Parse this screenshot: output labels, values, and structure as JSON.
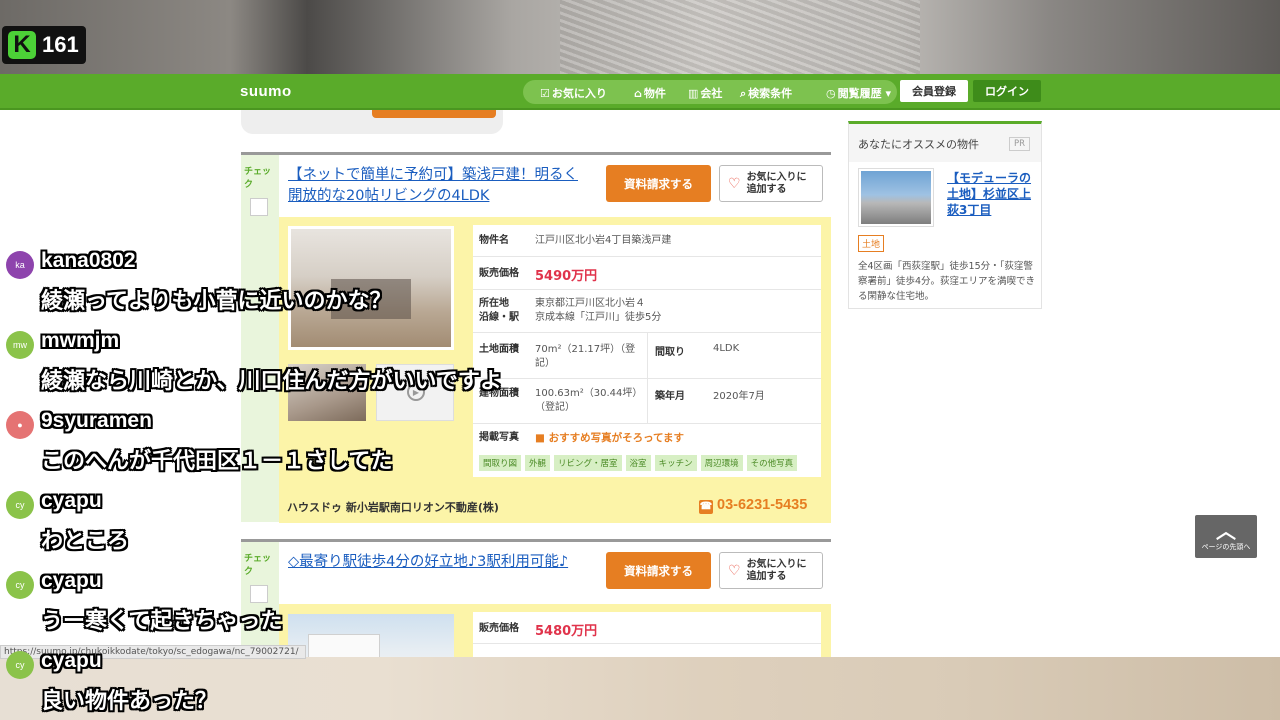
{
  "stream": {
    "view_count": "161",
    "status_url": "https://suumo.jp/chukoikkodate/tokyo/sc_edogawa/nc_79002721/"
  },
  "header": {
    "logo": "suumo",
    "nav": [
      "お気に入り",
      "物件",
      "会社",
      "検索条件",
      "閲覧履歴"
    ],
    "register_label": "会員登録",
    "login_label": "ログイン"
  },
  "listings": [
    {
      "check_tag": "チェック",
      "title": "【ネットで簡単に予約可】築浅戸建！明るく開放的な20帖リビングの4LDK",
      "request_button": "資料請求する",
      "fav_button": "お気に入りに追加する",
      "rows": {
        "name_label": "物件名",
        "name": "江戸川区北小岩4丁目築浅戸建",
        "price_label": "販売価格",
        "price": "5490万円",
        "address_label": "所在地",
        "address": "東京都江戸川区北小岩４",
        "line_label": "沿線・駅",
        "line": "京成本線「江戸川」徒歩5分",
        "land_label": "土地面積",
        "land": "70m²（21.17坪）（登記）",
        "layout_label": "間取り",
        "layout": "4LDK",
        "building_label": "建物面積",
        "building": "100.63m²（30.44坪）（登記）",
        "built_label": "築年月",
        "built": "2020年7月",
        "photos_label": "掲載写真",
        "photos_note": "おすすめ写真がそろってます"
      },
      "photo_chips": [
        "間取り図",
        "外観",
        "リビング・居室",
        "浴室",
        "キッチン",
        "周辺環境",
        "その他写真"
      ],
      "company": "ハウスドゥ 新小岩駅南口リオン不動産(株)",
      "phone": "03-6231-5435"
    },
    {
      "check_tag": "チェック",
      "title": "◇最寄り駅徒歩4分の好立地♪3駅利用可能♪",
      "request_button": "資料請求する",
      "fav_button": "お気に入りに追加する",
      "rows": {
        "price_label": "販売価格",
        "price": "5480万円"
      }
    }
  ],
  "sidebar": {
    "title": "あなたにオススメの物件",
    "pr": "PR",
    "link": "【モデューラの土地】杉並区上荻3丁目",
    "tag": "土地",
    "desc": "全4区画「西荻窪駅」徒歩15分・「荻窪警察署前」徒歩4分。荻窪エリアを満喫できる閑静な住宅地。"
  },
  "back_to_top": "ページの先頭へ",
  "chat": [
    {
      "user": "kana0802",
      "initials": "ka",
      "color": "#8e44ad",
      "text": "綾瀬ってよりも小菅に近いのかな？"
    },
    {
      "user": "mwmjm",
      "initials": "mw",
      "color": "#8bc34a",
      "text": "綾瀬なら川崎とか、川口住んだ方がいいですよ"
    },
    {
      "user": "9syuramen",
      "initials": "",
      "color": "#e57373",
      "text": "このへんが千代田区１－１さしてた"
    },
    {
      "user": "cyapu",
      "initials": "cy",
      "color": "#8bc34a",
      "text": "わところ"
    },
    {
      "user": "cyapu",
      "initials": "cy",
      "color": "#8bc34a",
      "text": "うー寒くて起きちゃった"
    },
    {
      "user": "cyapu",
      "initials": "cy",
      "color": "#8bc34a",
      "text": "良い物件あった？"
    }
  ]
}
